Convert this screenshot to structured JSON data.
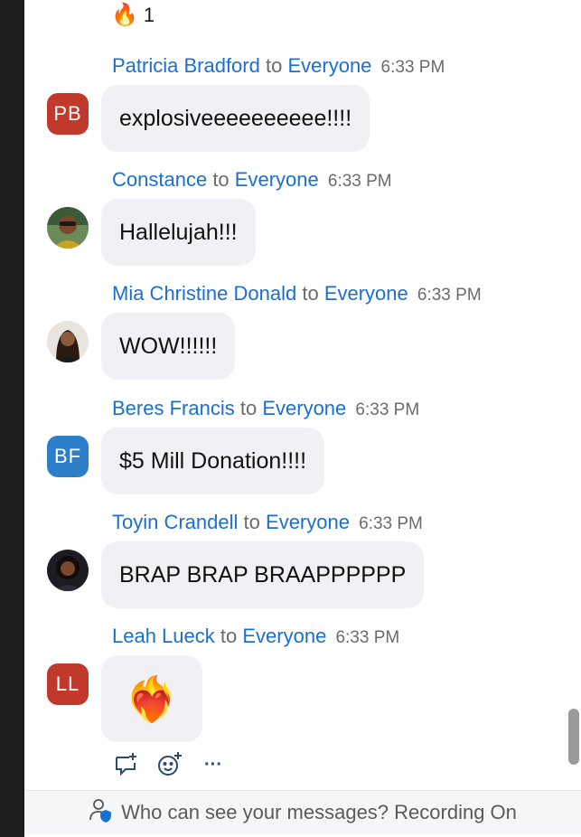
{
  "reaction": {
    "emoji": "🔥",
    "count": "1"
  },
  "messages": [
    {
      "sender": "Patricia Bradford",
      "to": "to",
      "audience": "Everyone",
      "time": "6:33 PM",
      "avatar": "PB",
      "text": "explosiveeeeeeeeee!!!!"
    },
    {
      "sender": "Constance",
      "to": "to",
      "audience": "Everyone",
      "time": "6:33 PM",
      "avatar": "",
      "text": "Hallelujah!!!"
    },
    {
      "sender": "Mia Christine Donald",
      "to": "to",
      "audience": "Everyone",
      "time": "6:33 PM",
      "avatar": "",
      "text": "WOW!!!!!!"
    },
    {
      "sender": "Beres Francis",
      "to": "to",
      "audience": "Everyone",
      "time": "6:33 PM",
      "avatar": "BF",
      "text": "$5 Mill Donation!!!!"
    },
    {
      "sender": "Toyin Crandell",
      "to": "to",
      "audience": "Everyone",
      "time": "6:33 PM",
      "avatar": "",
      "text": "BRAP BRAP BRAAPPPPPP"
    },
    {
      "sender": "Leah Lueck",
      "to": "to",
      "audience": "Everyone",
      "time": "6:33 PM",
      "avatar": "LL",
      "text": "❤️‍🔥"
    }
  ],
  "actions": {
    "more": "···"
  },
  "footer": {
    "text": "Who can see your messages? Recording On"
  }
}
